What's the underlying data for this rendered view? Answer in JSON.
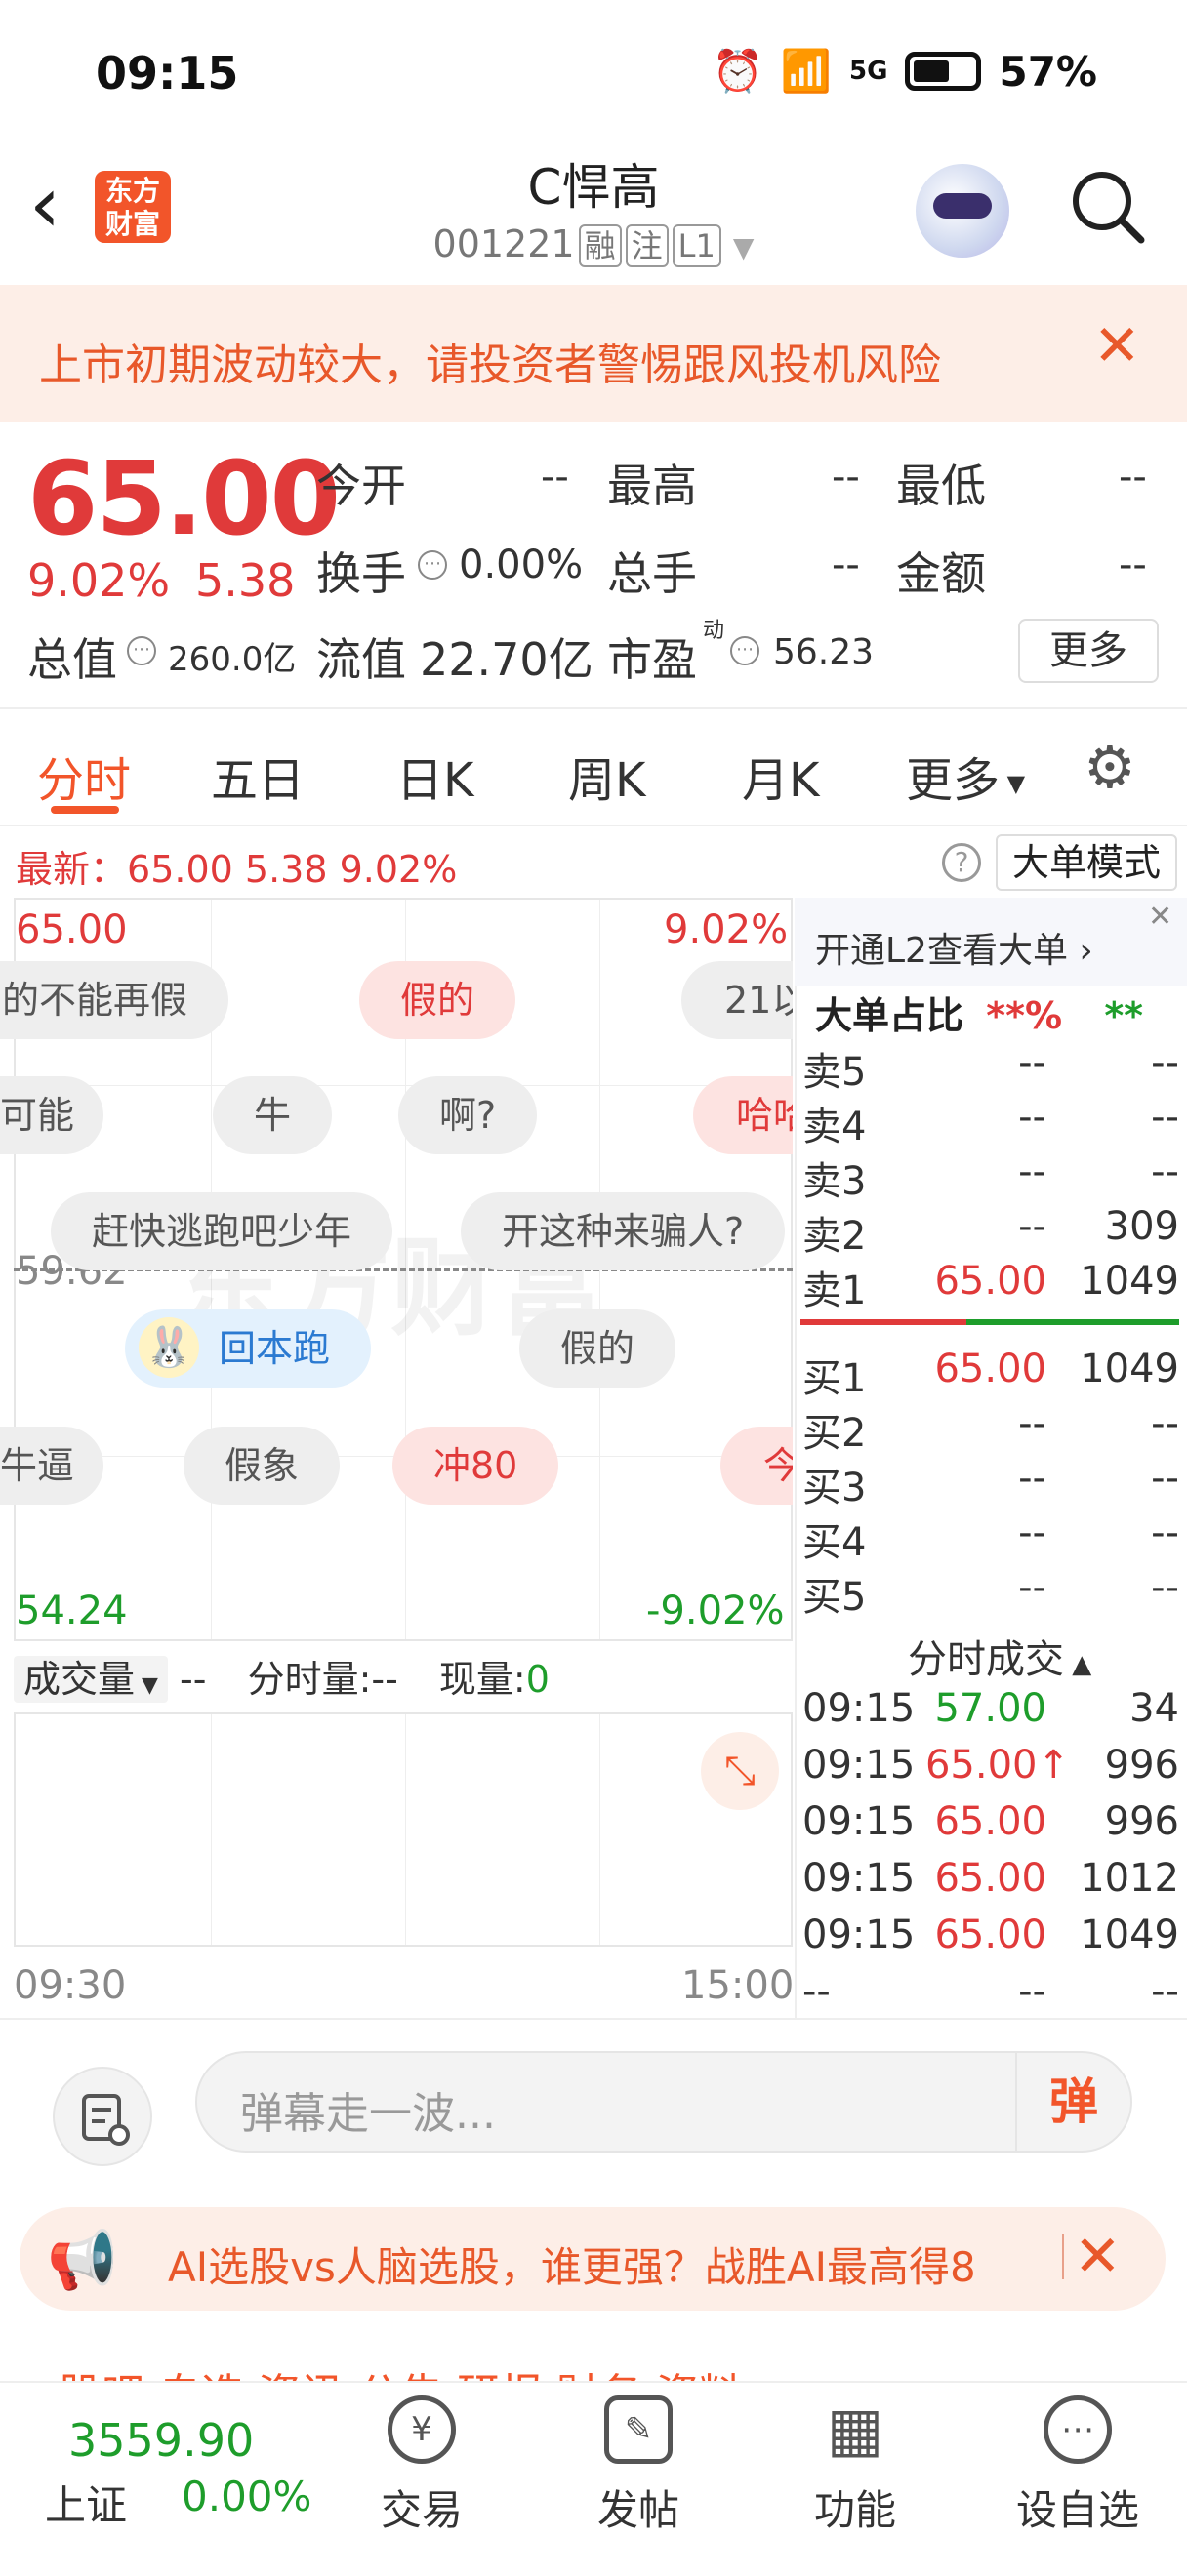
{
  "status": {
    "time": "09:15",
    "network": "5G",
    "battery": "57%"
  },
  "header": {
    "logo_line1": "东方",
    "logo_line2": "财富",
    "stock_name": "C悍高",
    "stock_code": "001221",
    "tags": [
      "融",
      "注",
      "L1"
    ]
  },
  "warning": {
    "text": "上市初期波动较大，请投资者警惕跟风投机风险"
  },
  "quote": {
    "price": "65.00",
    "change_pct": "9.02%",
    "change": "5.38",
    "fields": [
      {
        "label": "今开",
        "value": "--"
      },
      {
        "label": "最高",
        "value": "--"
      },
      {
        "label": "最低",
        "value": "--"
      },
      {
        "label": "换手",
        "value": "0.00%"
      },
      {
        "label": "总手",
        "value": "--"
      },
      {
        "label": "金额",
        "value": "--"
      },
      {
        "label": "总值",
        "value": "260.0亿"
      },
      {
        "label": "流值",
        "value": "22.70亿"
      },
      {
        "label": "市盈",
        "sup": "动",
        "value": "56.23"
      }
    ],
    "more_label": "更多"
  },
  "tabs": [
    "分时",
    "五日",
    "日K",
    "周K",
    "月K",
    "更多"
  ],
  "latest": {
    "label": "最新：",
    "price": "65.00",
    "change": "5.38",
    "pct": "9.02%"
  },
  "big_order_mode": "大单模式",
  "chart": {
    "y_top": "65.00",
    "pct_top": "9.02%",
    "y_mid": "59.62",
    "y_bottom": "54.24",
    "pct_bottom": "-9.02%",
    "watermark": "东方财富",
    "danmu": [
      "的不能再假",
      "假的",
      "21以",
      "可能",
      "牛",
      "啊?",
      "哈哈",
      "赶快逃跑吧少年",
      "开这种来骗人?",
      "回本跑",
      "假的",
      "牛逼",
      "假象",
      "冲80",
      "今"
    ]
  },
  "volume": {
    "selector": "成交量",
    "value": "--",
    "fs_label": "分时量:",
    "fs_value": "--",
    "now_label": "现量:",
    "now_value": "0"
  },
  "time_axis": {
    "start": "09:30",
    "end": "15:00"
  },
  "orderbook": {
    "l2_banner": "开通L2查看大单",
    "big_ratio_label": "大单占比",
    "big_ratio_a": "**%",
    "big_ratio_b": "**",
    "asks": [
      {
        "label": "卖5",
        "price": "--",
        "vol": "--"
      },
      {
        "label": "卖4",
        "price": "--",
        "vol": "--"
      },
      {
        "label": "卖3",
        "price": "--",
        "vol": "--"
      },
      {
        "label": "卖2",
        "price": "--",
        "vol": "309"
      },
      {
        "label": "卖1",
        "price": "65.00",
        "vol": "1049"
      }
    ],
    "bids": [
      {
        "label": "买1",
        "price": "65.00",
        "vol": "1049"
      },
      {
        "label": "买2",
        "price": "--",
        "vol": "--"
      },
      {
        "label": "买3",
        "price": "--",
        "vol": "--"
      },
      {
        "label": "买4",
        "price": "--",
        "vol": "--"
      },
      {
        "label": "买5",
        "price": "--",
        "vol": "--"
      }
    ],
    "ticks_header": "分时成交",
    "ticks": [
      {
        "time": "09:15",
        "price": "57.00",
        "vol": "34"
      },
      {
        "time": "09:15",
        "price": "65.00↑",
        "vol": "996"
      },
      {
        "time": "09:15",
        "price": "65.00",
        "vol": "996"
      },
      {
        "time": "09:15",
        "price": "65.00",
        "vol": "1012"
      },
      {
        "time": "09:15",
        "price": "65.00",
        "vol": "1049"
      },
      {
        "time": "--",
        "price": "--",
        "vol": "--"
      }
    ]
  },
  "comment": {
    "placeholder": "弹幕走一波...",
    "send": "弹"
  },
  "ad": {
    "text": "AI选股vs人脑选股，谁更强？战胜AI最高得8"
  },
  "subnav": "股吧  自选  资讯  公告  研报  财务  资料",
  "bottom": {
    "index_value": "3559.90",
    "index_name": "上证",
    "index_pct": "0.00%",
    "nav": [
      "交易",
      "发帖",
      "功能",
      "设自选"
    ]
  },
  "colors": {
    "accent": "#f2552a",
    "up": "#e03a3a",
    "down": "#1e9d2b"
  }
}
